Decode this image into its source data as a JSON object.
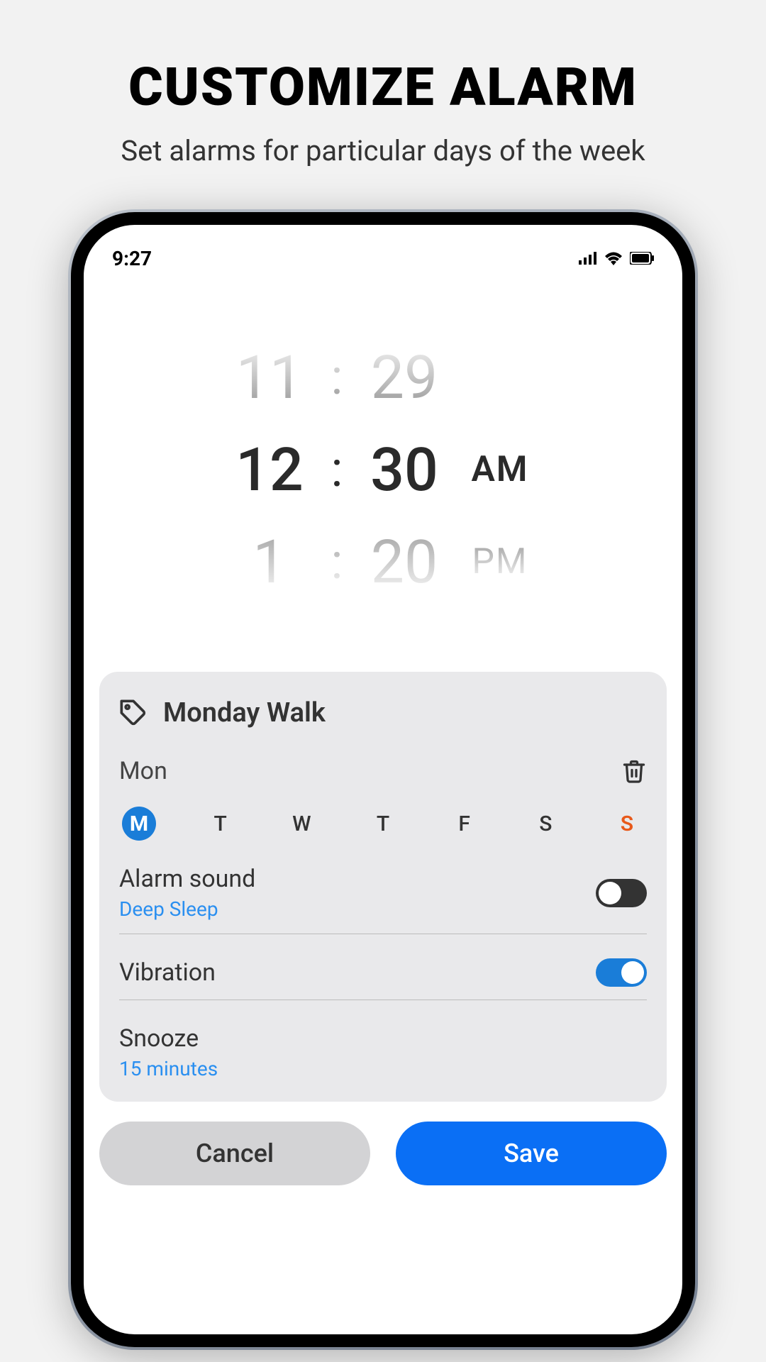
{
  "promo": {
    "title": "CUSTOMIZE ALARM",
    "subtitle": "Set alarms for particular days of the week"
  },
  "status": {
    "time": "9:27"
  },
  "picker": {
    "prev": {
      "hour": "11",
      "minute": "29",
      "ampm": ""
    },
    "current": {
      "hour": "12",
      "minute": "30",
      "ampm": "AM"
    },
    "next": {
      "hour": "1",
      "minute": "20",
      "ampm": "PM"
    }
  },
  "alarm": {
    "name": "Monday Walk",
    "selected_day_label": "Mon",
    "days": [
      {
        "letter": "M",
        "selected": true
      },
      {
        "letter": "T",
        "selected": false
      },
      {
        "letter": "W",
        "selected": false
      },
      {
        "letter": "T",
        "selected": false
      },
      {
        "letter": "F",
        "selected": false
      },
      {
        "letter": "S",
        "selected": false
      },
      {
        "letter": "S",
        "selected": false,
        "sunday": true
      }
    ],
    "sound": {
      "label": "Alarm sound",
      "value": "Deep Sleep",
      "enabled": false
    },
    "vibration": {
      "label": "Vibration",
      "enabled": true
    },
    "snooze": {
      "label": "Snooze",
      "value": "15 minutes"
    }
  },
  "actions": {
    "cancel": "Cancel",
    "save": "Save"
  }
}
